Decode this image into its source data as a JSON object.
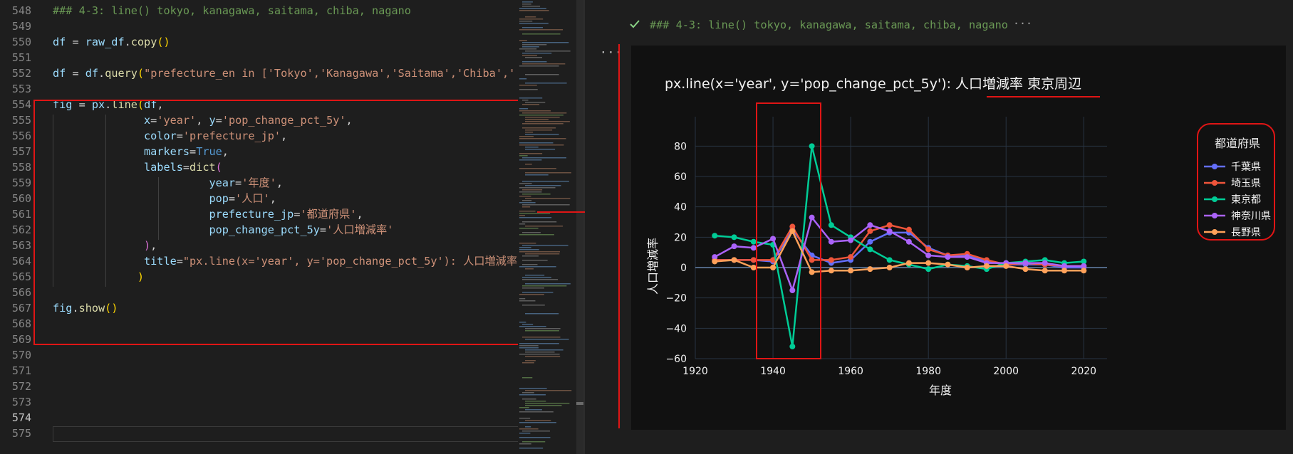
{
  "editor": {
    "lines": [
      {
        "n": "548",
        "seg": [
          [
            "c-comment",
            "### 4-3: line() tokyo, kanagawa, saitama, chiba, nagano"
          ]
        ]
      },
      {
        "n": "549",
        "seg": []
      },
      {
        "n": "550",
        "seg": [
          [
            "c-var",
            "df"
          ],
          [
            "c-txt",
            " = "
          ],
          [
            "c-var",
            "raw_df"
          ],
          [
            "c-txt",
            "."
          ],
          [
            "c-fn",
            "copy"
          ],
          [
            "c-b1",
            "()"
          ]
        ]
      },
      {
        "n": "551",
        "seg": []
      },
      {
        "n": "552",
        "seg": [
          [
            "c-var",
            "df"
          ],
          [
            "c-txt",
            " = "
          ],
          [
            "c-var",
            "df"
          ],
          [
            "c-txt",
            "."
          ],
          [
            "c-fn",
            "query"
          ],
          [
            "c-b1",
            "("
          ],
          [
            "c-str",
            "\"prefecture_en in ['Tokyo','Kanagawa','Saitama','Chiba','"
          ]
        ]
      },
      {
        "n": "553",
        "seg": []
      },
      {
        "n": "554",
        "seg": [
          [
            "c-var",
            "fig"
          ],
          [
            "c-txt",
            " = "
          ],
          [
            "c-var",
            "px"
          ],
          [
            "c-txt",
            "."
          ],
          [
            "c-fn",
            "line"
          ],
          [
            "c-b1",
            "("
          ],
          [
            "c-var",
            "df"
          ],
          [
            "c-txt",
            ","
          ]
        ]
      },
      {
        "n": "555",
        "seg": [
          [
            "c-txt",
            "              "
          ],
          [
            "c-var",
            "x"
          ],
          [
            "c-txt",
            "="
          ],
          [
            "c-str",
            "'year'"
          ],
          [
            "c-txt",
            ", "
          ],
          [
            "c-var",
            "y"
          ],
          [
            "c-txt",
            "="
          ],
          [
            "c-str",
            "'pop_change_pct_5y'"
          ],
          [
            "c-txt",
            ","
          ]
        ]
      },
      {
        "n": "556",
        "seg": [
          [
            "c-txt",
            "              "
          ],
          [
            "c-var",
            "color"
          ],
          [
            "c-txt",
            "="
          ],
          [
            "c-str",
            "'prefecture_jp'"
          ],
          [
            "c-txt",
            ","
          ]
        ]
      },
      {
        "n": "557",
        "seg": [
          [
            "c-txt",
            "              "
          ],
          [
            "c-var",
            "markers"
          ],
          [
            "c-txt",
            "="
          ],
          [
            "c-const",
            "True"
          ],
          [
            "c-txt",
            ","
          ]
        ]
      },
      {
        "n": "558",
        "seg": [
          [
            "c-txt",
            "              "
          ],
          [
            "c-var",
            "labels"
          ],
          [
            "c-txt",
            "="
          ],
          [
            "c-fn",
            "dict"
          ],
          [
            "c-b2",
            "("
          ]
        ]
      },
      {
        "n": "559",
        "seg": [
          [
            "c-txt",
            "                        "
          ],
          [
            "c-var",
            "year"
          ],
          [
            "c-txt",
            "="
          ],
          [
            "c-str",
            "'年度'"
          ],
          [
            "c-txt",
            ","
          ]
        ]
      },
      {
        "n": "560",
        "seg": [
          [
            "c-txt",
            "                        "
          ],
          [
            "c-var",
            "pop"
          ],
          [
            "c-txt",
            "="
          ],
          [
            "c-str",
            "'人口'"
          ],
          [
            "c-txt",
            ","
          ]
        ]
      },
      {
        "n": "561",
        "seg": [
          [
            "c-txt",
            "                        "
          ],
          [
            "c-var",
            "prefecture_jp"
          ],
          [
            "c-txt",
            "="
          ],
          [
            "c-str",
            "'都道府県'"
          ],
          [
            "c-txt",
            ","
          ]
        ]
      },
      {
        "n": "562",
        "seg": [
          [
            "c-txt",
            "                        "
          ],
          [
            "c-var",
            "pop_change_pct_5y"
          ],
          [
            "c-txt",
            "="
          ],
          [
            "c-str",
            "'人口増減率'"
          ]
        ]
      },
      {
        "n": "563",
        "seg": [
          [
            "c-txt",
            "              "
          ],
          [
            "c-b2",
            ")"
          ],
          [
            "c-txt",
            ","
          ]
        ]
      },
      {
        "n": "564",
        "seg": [
          [
            "c-txt",
            "              "
          ],
          [
            "c-var",
            "title"
          ],
          [
            "c-txt",
            "="
          ],
          [
            "c-str",
            "\"px.line(x='year', y='pop_change_pct_5y'): 人口増減率"
          ]
        ]
      },
      {
        "n": "565",
        "seg": [
          [
            "c-txt",
            "             "
          ],
          [
            "c-b1",
            ")"
          ]
        ]
      },
      {
        "n": "566",
        "seg": []
      },
      {
        "n": "567",
        "seg": [
          [
            "c-var",
            "fig"
          ],
          [
            "c-txt",
            "."
          ],
          [
            "c-fn",
            "show"
          ],
          [
            "c-b1",
            "()"
          ]
        ]
      },
      {
        "n": "568",
        "seg": []
      },
      {
        "n": "569",
        "seg": []
      },
      {
        "n": "570",
        "seg": []
      },
      {
        "n": "571",
        "seg": []
      },
      {
        "n": "572",
        "seg": []
      },
      {
        "n": "573",
        "seg": []
      },
      {
        "n": "574",
        "seg": []
      },
      {
        "n": "575",
        "seg": []
      }
    ],
    "current_line": "574"
  },
  "output": {
    "header": "### 4-3: line() tokyo, kanagawa, saitama, chiba, nagano",
    "header_more": "···",
    "dots": "···",
    "check_icon": "check-icon"
  },
  "colors": {
    "highlight": "#e01515",
    "plot_bg": "#111111",
    "grid": "#283442"
  },
  "chart_data": {
    "type": "line",
    "title": "px.line(x='year', y='pop_change_pct_5y'): 人口増減率 東京周辺",
    "xlabel": "年度",
    "ylabel": "人口増減率",
    "xlim": [
      1920,
      2026
    ],
    "ylim": [
      -60,
      90
    ],
    "xticks": [
      1920,
      1940,
      1960,
      1980,
      2000,
      2020
    ],
    "yticks": [
      -60,
      -40,
      -20,
      0,
      20,
      40,
      60,
      80
    ],
    "legend_title": "都道府県",
    "legend_position": "top-right",
    "x": [
      1925,
      1930,
      1935,
      1940,
      1945,
      1950,
      1955,
      1960,
      1965,
      1970,
      1975,
      1980,
      1985,
      1990,
      1995,
      2000,
      2005,
      2010,
      2015,
      2020
    ],
    "series": [
      {
        "name": "千葉県",
        "color": "#636efa",
        "values": [
          5,
          5,
          5,
          4,
          25,
          8,
          3,
          5,
          17,
          23,
          23,
          13,
          8,
          8,
          4,
          2,
          2,
          2,
          0,
          0
        ]
      },
      {
        "name": "埼玉県",
        "color": "#ef553b",
        "values": [
          5,
          5,
          5,
          5,
          27,
          5,
          5,
          7,
          24,
          28,
          25,
          12,
          8,
          9,
          5,
          2,
          3,
          2,
          1,
          1
        ]
      },
      {
        "name": "東京都",
        "color": "#00cc96",
        "values": [
          21,
          20,
          17,
          15,
          -52,
          80,
          28,
          20,
          12,
          5,
          2,
          -1,
          2,
          1,
          -1,
          3,
          4,
          5,
          3,
          4
        ]
      },
      {
        "name": "神奈川県",
        "color": "#ab63fa",
        "values": [
          7,
          14,
          13,
          19,
          -15,
          33,
          17,
          18,
          28,
          24,
          17,
          8,
          7,
          7,
          3,
          3,
          3,
          3,
          1,
          1
        ]
      },
      {
        "name": "長野県",
        "color": "#ffa15a",
        "values": [
          4,
          5,
          0,
          0,
          24,
          -3,
          -2,
          -2,
          -1,
          0,
          3,
          3,
          2,
          0,
          1,
          1,
          -1,
          -2,
          -2,
          -2
        ]
      }
    ]
  }
}
